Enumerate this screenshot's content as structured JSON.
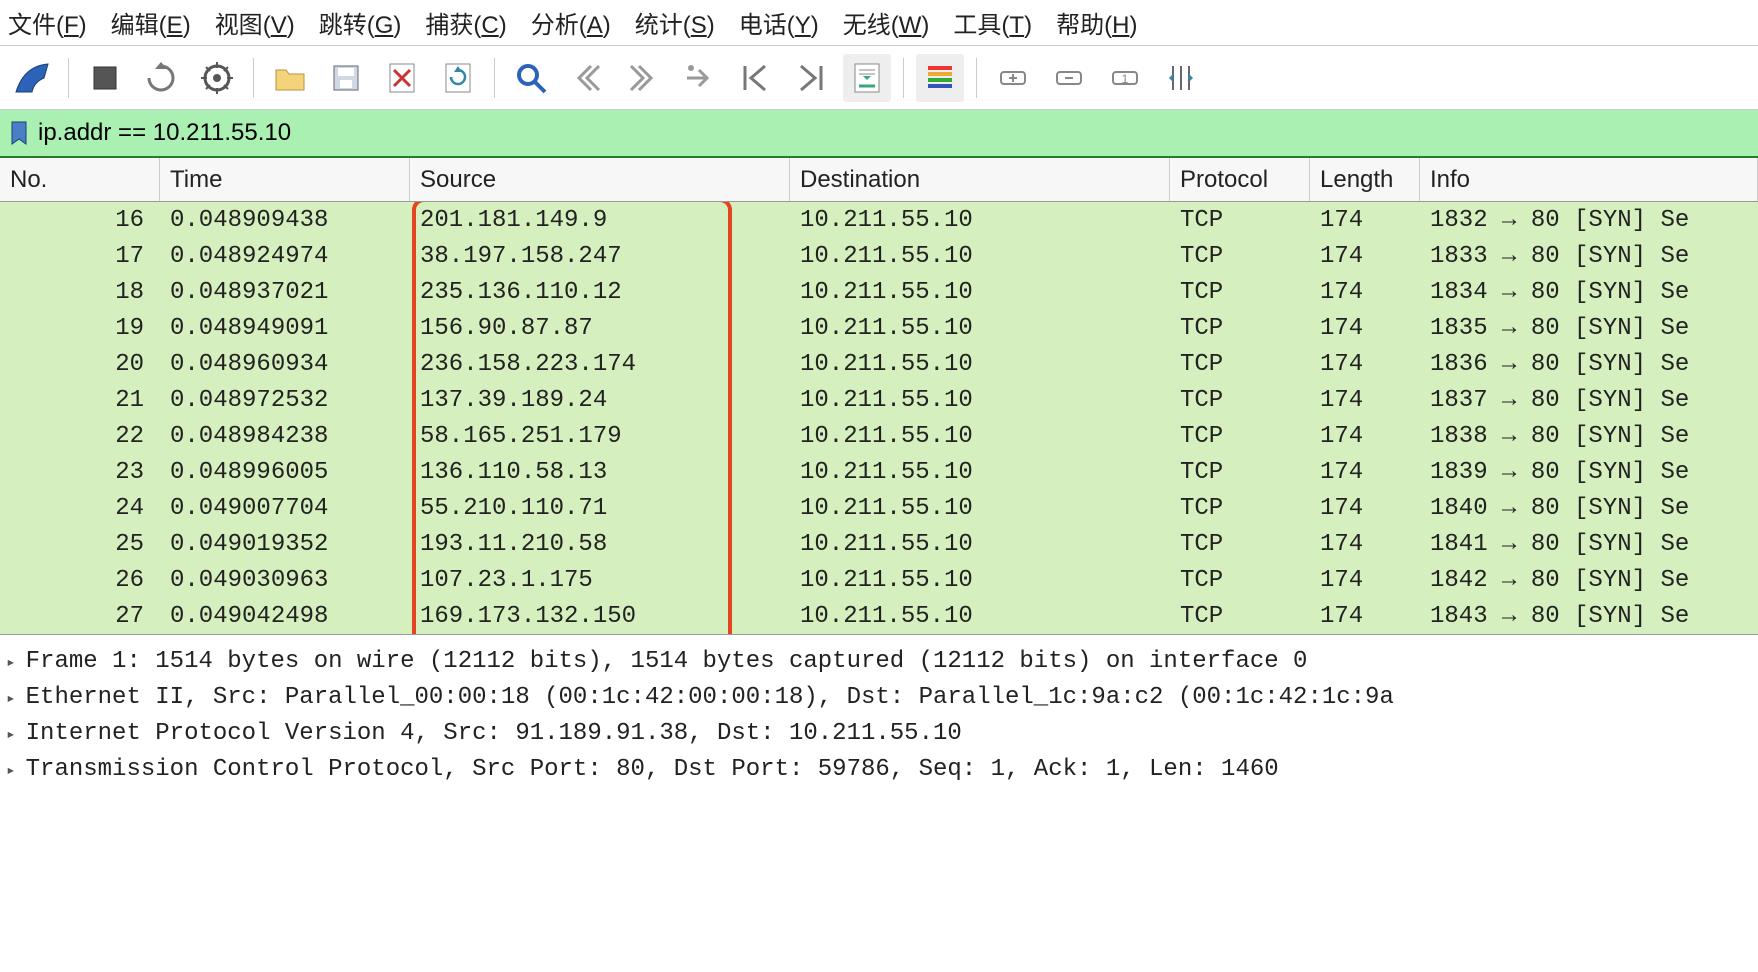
{
  "menu": {
    "file": {
      "label": "文件",
      "accel": "F"
    },
    "edit": {
      "label": "编辑",
      "accel": "E"
    },
    "view": {
      "label": "视图",
      "accel": "V"
    },
    "goto": {
      "label": "跳转",
      "accel": "G"
    },
    "capture": {
      "label": "捕获",
      "accel": "C"
    },
    "analyze": {
      "label": "分析",
      "accel": "A"
    },
    "stats": {
      "label": "统计",
      "accel": "S"
    },
    "tele": {
      "label": "电话",
      "accel": "Y"
    },
    "wireless": {
      "label": "无线",
      "accel": "W"
    },
    "tools": {
      "label": "工具",
      "accel": "T"
    },
    "help": {
      "label": "帮助",
      "accel": "H"
    }
  },
  "filter": {
    "value": "ip.addr == 10.211.55.10"
  },
  "columns": {
    "no": "No.",
    "time": "Time",
    "source": "Source",
    "destination": "Destination",
    "protocol": "Protocol",
    "length": "Length",
    "info": "Info"
  },
  "packets": [
    {
      "no": "16",
      "time": "0.048909438",
      "src": "201.181.149.9",
      "dst": "10.211.55.10",
      "proto": "TCP",
      "len": "174",
      "info": "1832 → 80 [SYN] Se"
    },
    {
      "no": "17",
      "time": "0.048924974",
      "src": "38.197.158.247",
      "dst": "10.211.55.10",
      "proto": "TCP",
      "len": "174",
      "info": "1833 → 80 [SYN] Se"
    },
    {
      "no": "18",
      "time": "0.048937021",
      "src": "235.136.110.12",
      "dst": "10.211.55.10",
      "proto": "TCP",
      "len": "174",
      "info": "1834 → 80 [SYN] Se"
    },
    {
      "no": "19",
      "time": "0.048949091",
      "src": "156.90.87.87",
      "dst": "10.211.55.10",
      "proto": "TCP",
      "len": "174",
      "info": "1835 → 80 [SYN] Se"
    },
    {
      "no": "20",
      "time": "0.048960934",
      "src": "236.158.223.174",
      "dst": "10.211.55.10",
      "proto": "TCP",
      "len": "174",
      "info": "1836 → 80 [SYN] Se"
    },
    {
      "no": "21",
      "time": "0.048972532",
      "src": "137.39.189.24",
      "dst": "10.211.55.10",
      "proto": "TCP",
      "len": "174",
      "info": "1837 → 80 [SYN] Se"
    },
    {
      "no": "22",
      "time": "0.048984238",
      "src": "58.165.251.179",
      "dst": "10.211.55.10",
      "proto": "TCP",
      "len": "174",
      "info": "1838 → 80 [SYN] Se"
    },
    {
      "no": "23",
      "time": "0.048996005",
      "src": "136.110.58.13",
      "dst": "10.211.55.10",
      "proto": "TCP",
      "len": "174",
      "info": "1839 → 80 [SYN] Se"
    },
    {
      "no": "24",
      "time": "0.049007704",
      "src": "55.210.110.71",
      "dst": "10.211.55.10",
      "proto": "TCP",
      "len": "174",
      "info": "1840 → 80 [SYN] Se"
    },
    {
      "no": "25",
      "time": "0.049019352",
      "src": "193.11.210.58",
      "dst": "10.211.55.10",
      "proto": "TCP",
      "len": "174",
      "info": "1841 → 80 [SYN] Se"
    },
    {
      "no": "26",
      "time": "0.049030963",
      "src": "107.23.1.175",
      "dst": "10.211.55.10",
      "proto": "TCP",
      "len": "174",
      "info": "1842 → 80 [SYN] Se"
    },
    {
      "no": "27",
      "time": "0.049042498",
      "src": "169.173.132.150",
      "dst": "10.211.55.10",
      "proto": "TCP",
      "len": "174",
      "info": "1843 → 80 [SYN] Se"
    }
  ],
  "details": {
    "frame": "Frame 1: 1514 bytes on wire (12112 bits), 1514 bytes captured (12112 bits) on interface 0",
    "eth": "Ethernet II, Src: Parallel_00:00:18 (00:1c:42:00:00:18), Dst: Parallel_1c:9a:c2 (00:1c:42:1c:9a",
    "ip": "Internet Protocol Version 4, Src: 91.189.91.38, Dst: 10.211.55.10",
    "tcp": "Transmission Control Protocol, Src Port: 80, Dst Port: 59786, Seq: 1, Ack: 1, Len: 1460"
  }
}
